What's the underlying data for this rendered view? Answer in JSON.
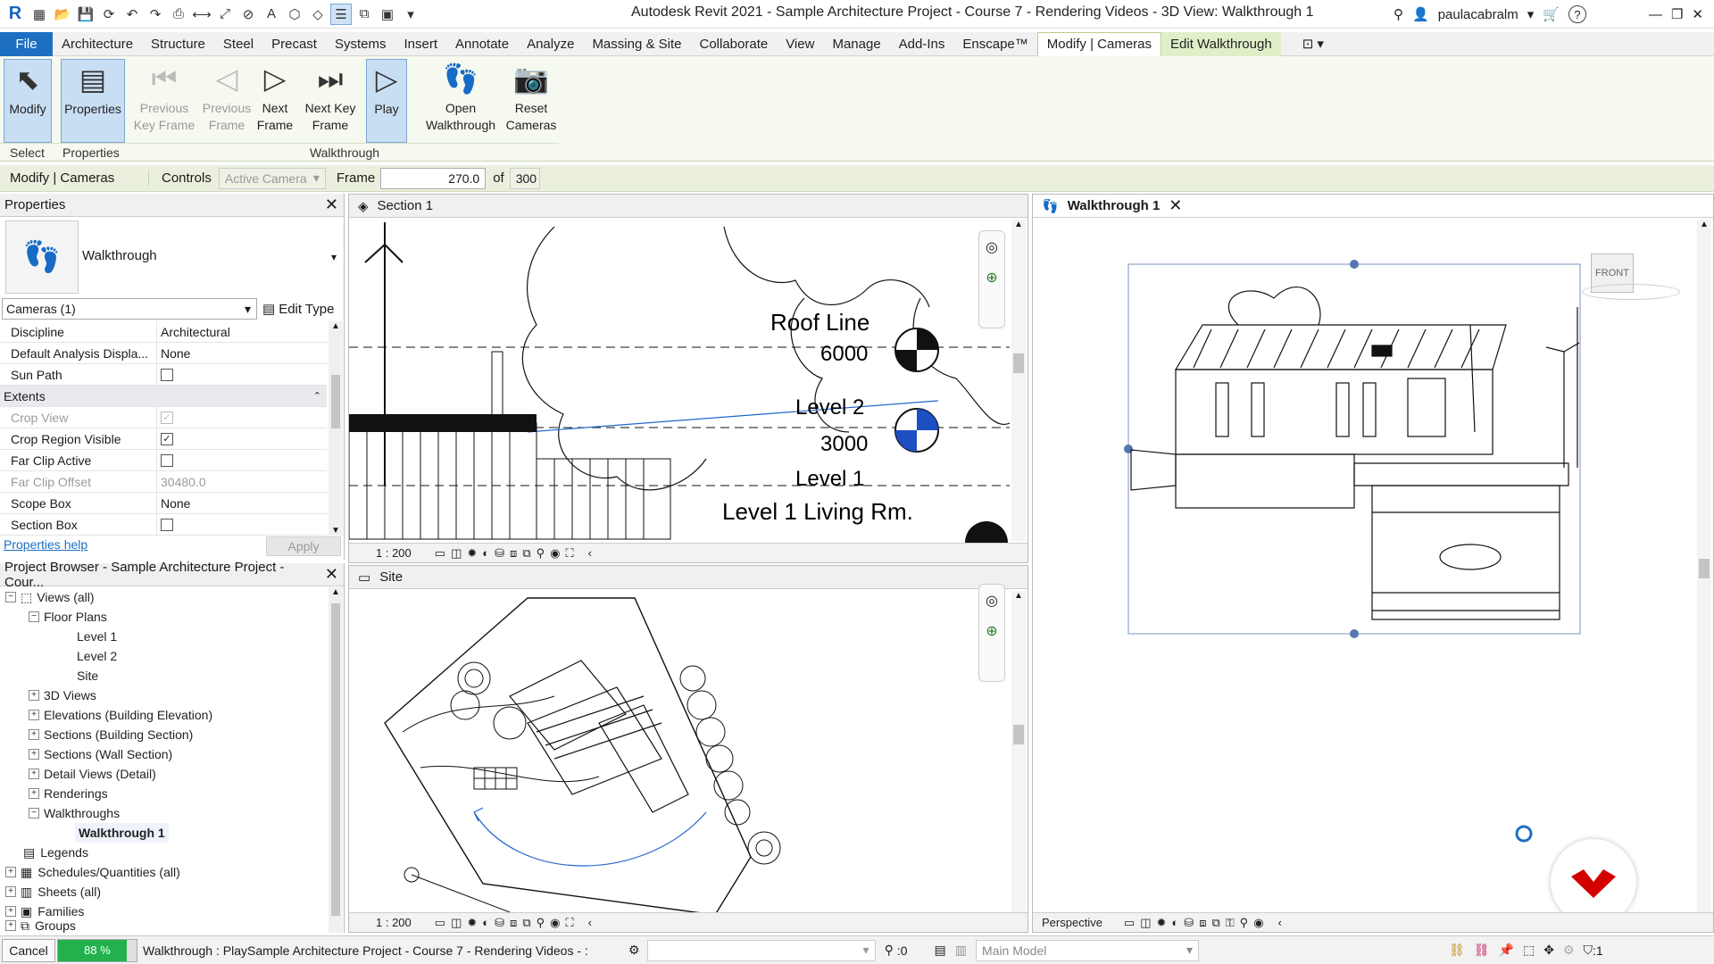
{
  "app": {
    "title": "Autodesk Revit 2021 - Sample Architecture Project - Course 7 - Rendering Videos - 3D View: Walkthrough 1",
    "user": "paulacabralm",
    "logo": "R"
  },
  "menu": {
    "tabs": [
      "File",
      "Architecture",
      "Structure",
      "Steel",
      "Precast",
      "Systems",
      "Insert",
      "Annotate",
      "Analyze",
      "Massing & Site",
      "Collaborate",
      "View",
      "Manage",
      "Add-Ins",
      "Enscape™",
      "Modify | Cameras",
      "Edit Walkthrough"
    ]
  },
  "ribbon": {
    "modify": "Modify",
    "properties": "Properties",
    "prev_key_frame": "Previous Key Frame",
    "prev_frame": "Previous Frame",
    "next_frame": "Next Frame",
    "next_key_frame": "Next Key Frame",
    "play": "Play",
    "open_walkthrough": "Open Walkthrough",
    "reset_cameras": "Reset Cameras",
    "panel_select": "Select",
    "panel_properties": "Properties",
    "panel_walkthrough": "Walkthrough"
  },
  "options": {
    "context": "Modify | Cameras",
    "controls_label": "Controls",
    "controls_value": "Active Camera",
    "frame_label": "Frame",
    "frame_value": "270.0",
    "of_label": "of",
    "total_frames": "300"
  },
  "properties": {
    "title": "Properties",
    "type_name": "Walkthrough",
    "selector": "Cameras (1)",
    "edit_type": "Edit Type",
    "rows": [
      {
        "key": "Discipline",
        "value": "Architectural"
      },
      {
        "key": "Default Analysis Displa...",
        "value": "None"
      },
      {
        "key": "Sun Path",
        "value": ""
      }
    ],
    "extents_label": "Extents",
    "extents_rows": [
      {
        "key": "Crop View",
        "value": ""
      },
      {
        "key": "Crop Region Visible",
        "value": ""
      },
      {
        "key": "Far Clip Active",
        "value": ""
      },
      {
        "key": "Far Clip Offset",
        "value": "30480.0"
      },
      {
        "key": "Scope Box",
        "value": "None"
      },
      {
        "key": "Section Box",
        "value": ""
      }
    ],
    "help": "Properties help",
    "apply": "Apply"
  },
  "browser": {
    "title": "Project Browser - Sample Architecture Project - Cour...",
    "nodes": {
      "views": "Views (all)",
      "floor_plans": "Floor Plans",
      "level1": "Level 1",
      "level2": "Level 2",
      "site": "Site",
      "views3d": "3D Views",
      "elevations": "Elevations (Building Elevation)",
      "sections_building": "Sections (Building Section)",
      "sections_wall": "Sections (Wall Section)",
      "detail_views": "Detail Views (Detail)",
      "renderings": "Renderings",
      "walkthroughs": "Walkthroughs",
      "walkthrough1": "Walkthrough 1",
      "legends": "Legends",
      "schedules": "Schedules/Quantities (all)",
      "sheets": "Sheets (all)",
      "families": "Families",
      "groups": "Groups"
    }
  },
  "views": {
    "section": {
      "title": "Section 1",
      "scale": "1 : 200",
      "levels": {
        "roof_line": "Roof Line",
        "roof_elev": "6000",
        "level2": "Level 2",
        "level2_elev": "3000",
        "level1": "Level 1",
        "level1_living": "Level 1 Living Rm."
      }
    },
    "site": {
      "title": "Site",
      "scale": "1 : 200"
    },
    "walkthrough": {
      "title": "Walkthrough 1",
      "mode": "Perspective",
      "viewcube": "FRONT"
    }
  },
  "status": {
    "cancel": "Cancel",
    "progress": "88 %",
    "progress_value": 0.88,
    "message": "Walkthrough : PlaySample Architecture Project - Course 7 - Rendering Videos - :",
    "count": ":0",
    "model": "Main Model",
    "filter": ":1"
  },
  "colors": {
    "file_tab": "#1d6fc1",
    "contextual": "#dfefc8",
    "progress": "#22b14c",
    "brand": "#d40000"
  }
}
